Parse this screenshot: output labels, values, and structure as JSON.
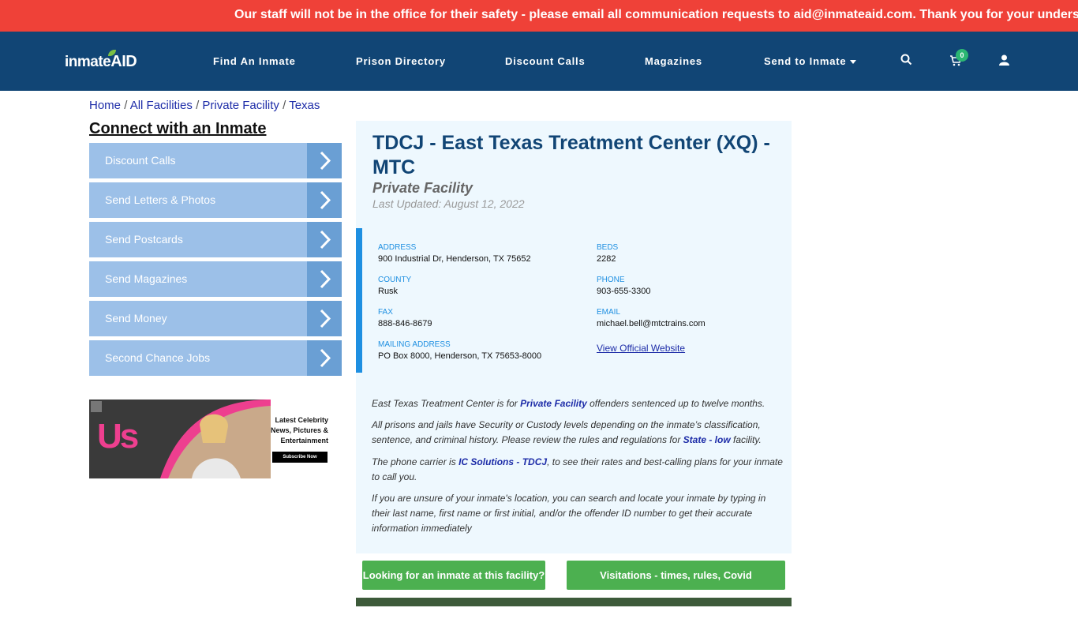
{
  "alert": {
    "text": "Our staff will not be in the office for their safety - please email all communication requests to aid@inmateaid.com. Thank you for your unders"
  },
  "nav": {
    "logo_part1": "inmate",
    "logo_part2": "AID",
    "links": [
      "Find An Inmate",
      "Prison Directory",
      "Discount Calls",
      "Magazines",
      "Send to Inmate"
    ],
    "cart_count": "0"
  },
  "breadcrumb": {
    "items": [
      "Home",
      "All Facilities",
      "Private Facility",
      "Texas"
    ],
    "sep": "/"
  },
  "sidebar": {
    "heading": "Connect with an Inmate",
    "buttons": [
      "Discount Calls",
      "Send Letters & Photos",
      "Send Postcards",
      "Send Magazines",
      "Send Money",
      "Second Chance Jobs"
    ],
    "ad": {
      "brand": "Us",
      "line1": "Latest Celebrity",
      "line2": "News, Pictures &",
      "line3": "Entertainment",
      "cta": "Subscribe Now"
    }
  },
  "facility": {
    "title": "TDCJ - East Texas Treatment Center (XQ) - MTC",
    "type": "Private Facility",
    "updated": "Last Updated: August 12, 2022",
    "address_label": "ADDRESS",
    "address": "900 Industrial Dr, Henderson, TX 75652",
    "beds_label": "BEDS",
    "beds": "2282",
    "county_label": "COUNTY",
    "county": "Rusk",
    "phone_label": "PHONE",
    "phone": "903-655-3300",
    "fax_label": "FAX",
    "fax": "888-846-8679",
    "email_label": "EMAIL",
    "email": "michael.bell@mtctrains.com",
    "mailing_label": "MAILING ADDRESS",
    "mailing": "PO Box 8000, Henderson, TX 75653-8000",
    "website_link": "View Official Website",
    "p1_a": "East Texas Treatment Center is for ",
    "p1_b": "Private Facility",
    "p1_c": " offenders sentenced up to twelve months.",
    "p2_a": "All prisons and jails have Security or Custody levels depending on the inmate’s classification, sentence, and criminal history. Please review the rules and regulations for ",
    "p2_b": "State - low",
    "p2_c": " facility.",
    "p3_a": "The phone carrier is ",
    "p3_b": "IC Solutions - TDCJ",
    "p3_c": ", to see their rates and best-calling plans for your inmate to call you.",
    "p4": "If you are unsure of your inmate's location, you can search and locate your inmate by typing in their last name, first name or first initial, and/or the offender ID number to get their accurate information immediately",
    "btn_looking": "Looking for an inmate at this facility?",
    "btn_visit": "Visitations - times, rules, Covid cancellations"
  },
  "colors": {
    "alert": "#ef4138",
    "nav": "#114575",
    "accent": "#1e8fe1",
    "green": "#4cb050",
    "sidebar_btn": "#9cc0e8"
  }
}
